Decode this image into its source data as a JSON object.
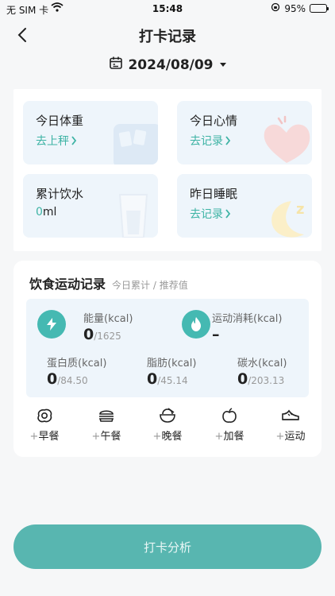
{
  "status_bar": {
    "carrier": "无 SIM 卡",
    "time": "15:48",
    "battery": "95%",
    "battery_level": 0.95
  },
  "nav": {
    "title": "打卡记录"
  },
  "date": {
    "value": "2024/08/09"
  },
  "tiles": {
    "weight": {
      "title": "今日体重",
      "action": "去上秤"
    },
    "mood": {
      "title": "今日心情",
      "action": "去记录"
    },
    "water": {
      "title": "累计饮水",
      "value": "0",
      "unit": "ml"
    },
    "sleep": {
      "title": "昨日睡眠",
      "action": "去记录"
    }
  },
  "diet": {
    "title": "饮食运动记录",
    "subtitle": "今日累计 / 推荐值",
    "energy": {
      "label": "能量(kcal)",
      "value": "0",
      "target": "/1625"
    },
    "exercise": {
      "label": "运动消耗(kcal)",
      "value": "–"
    },
    "protein": {
      "label": "蛋白质(kcal)",
      "value": "0",
      "target": "/84.50"
    },
    "fat": {
      "label": "脂肪(kcal)",
      "value": "0",
      "target": "/45.14"
    },
    "carbs": {
      "label": "碳水(kcal)",
      "value": "0",
      "target": "/203.13"
    },
    "meals": [
      {
        "plus": "+",
        "label": "早餐",
        "icon": "fried-egg-icon"
      },
      {
        "plus": "+",
        "label": "午餐",
        "icon": "burger-icon"
      },
      {
        "plus": "+",
        "label": "晚餐",
        "icon": "rice-bowl-icon"
      },
      {
        "plus": "+",
        "label": "加餐",
        "icon": "apple-icon"
      },
      {
        "plus": "+",
        "label": "运动",
        "icon": "sneaker-icon"
      }
    ]
  },
  "analyze_button": "打卡分析",
  "colors": {
    "accent": "#3db3a4",
    "button": "#58b6b0",
    "tile_bg": "#eef5fb"
  }
}
